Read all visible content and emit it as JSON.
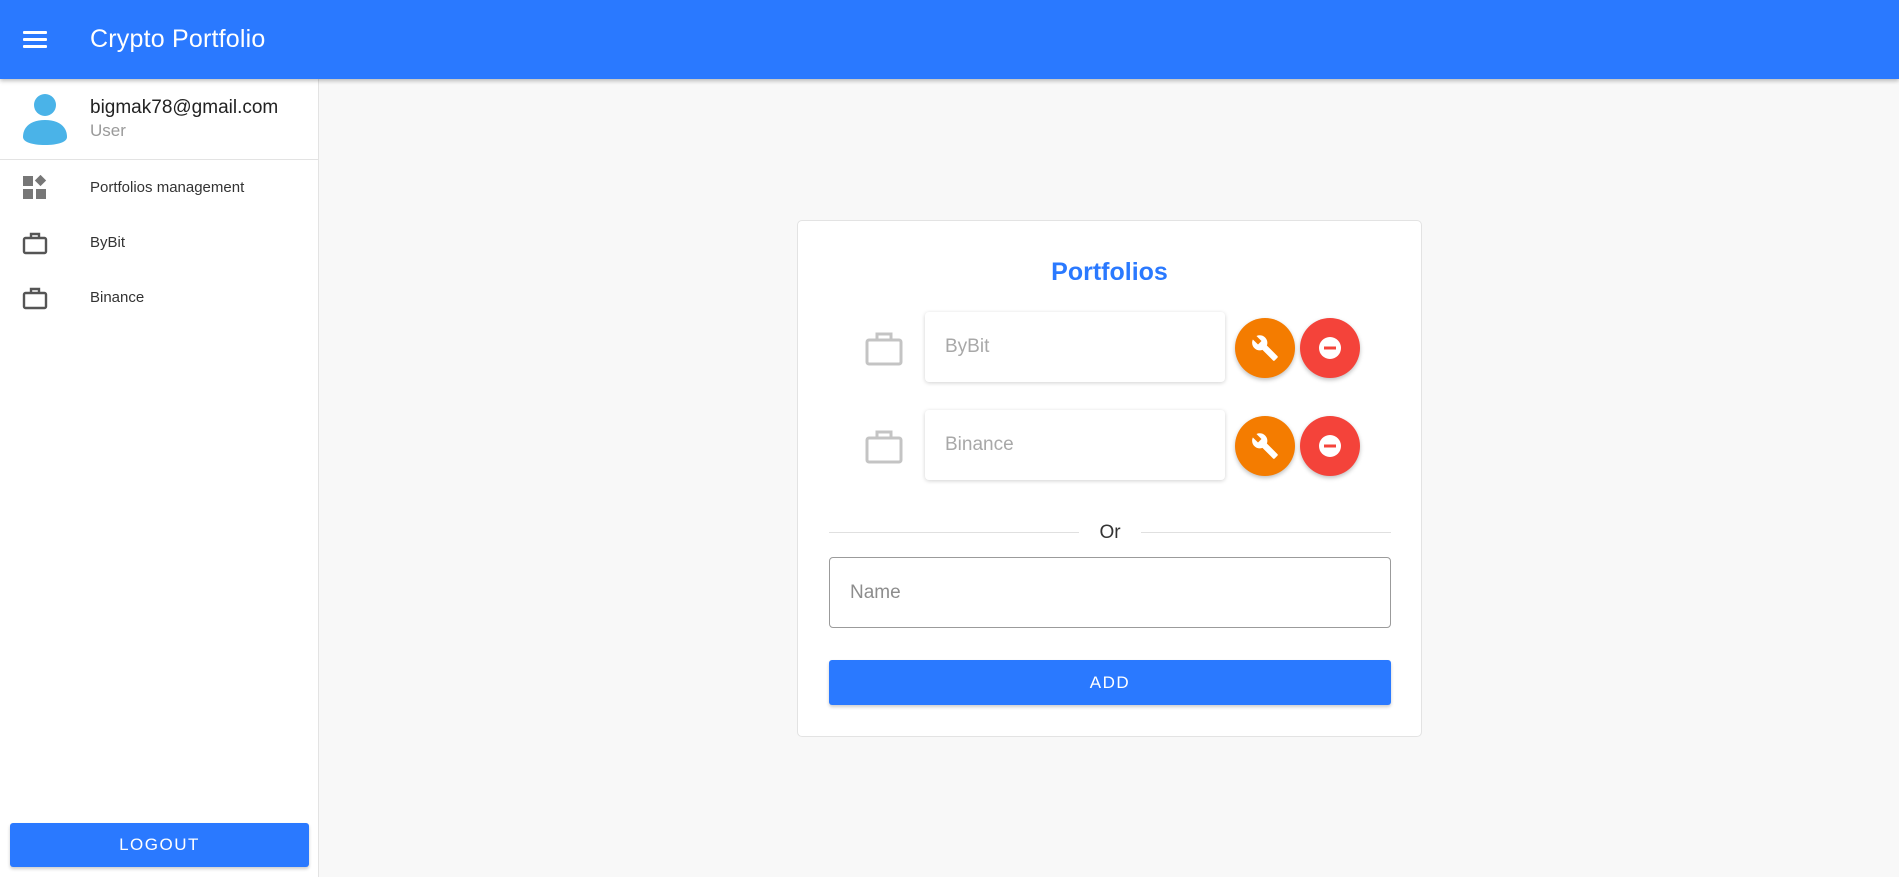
{
  "appbar": {
    "menu_icon": "menu-icon",
    "title": "Crypto Portfolio"
  },
  "drawer": {
    "user": {
      "avatar_icon": "person-icon",
      "email": "bigmak78@gmail.com",
      "role": "User"
    },
    "items": [
      {
        "icon": "dashboard-icon",
        "label": "Portfolios management"
      },
      {
        "icon": "briefcase-icon",
        "label": "ByBit"
      },
      {
        "icon": "briefcase-icon",
        "label": "Binance"
      }
    ],
    "logout_label": "Logout"
  },
  "card": {
    "title": "Portfolios",
    "portfolios": [
      {
        "icon": "briefcase-icon",
        "name": "ByBit",
        "edit_icon": "wrench-icon",
        "remove_icon": "minus-circle-icon"
      },
      {
        "icon": "briefcase-icon",
        "name": "Binance",
        "edit_icon": "wrench-icon",
        "remove_icon": "minus-circle-icon"
      }
    ],
    "divider_text": "Or",
    "name_placeholder": "Name",
    "add_label": "ADD"
  },
  "colors": {
    "primary": "#2a79ff",
    "edit": "#f47c00",
    "remove": "#f4433a",
    "avatar": "#4ab3e8"
  }
}
